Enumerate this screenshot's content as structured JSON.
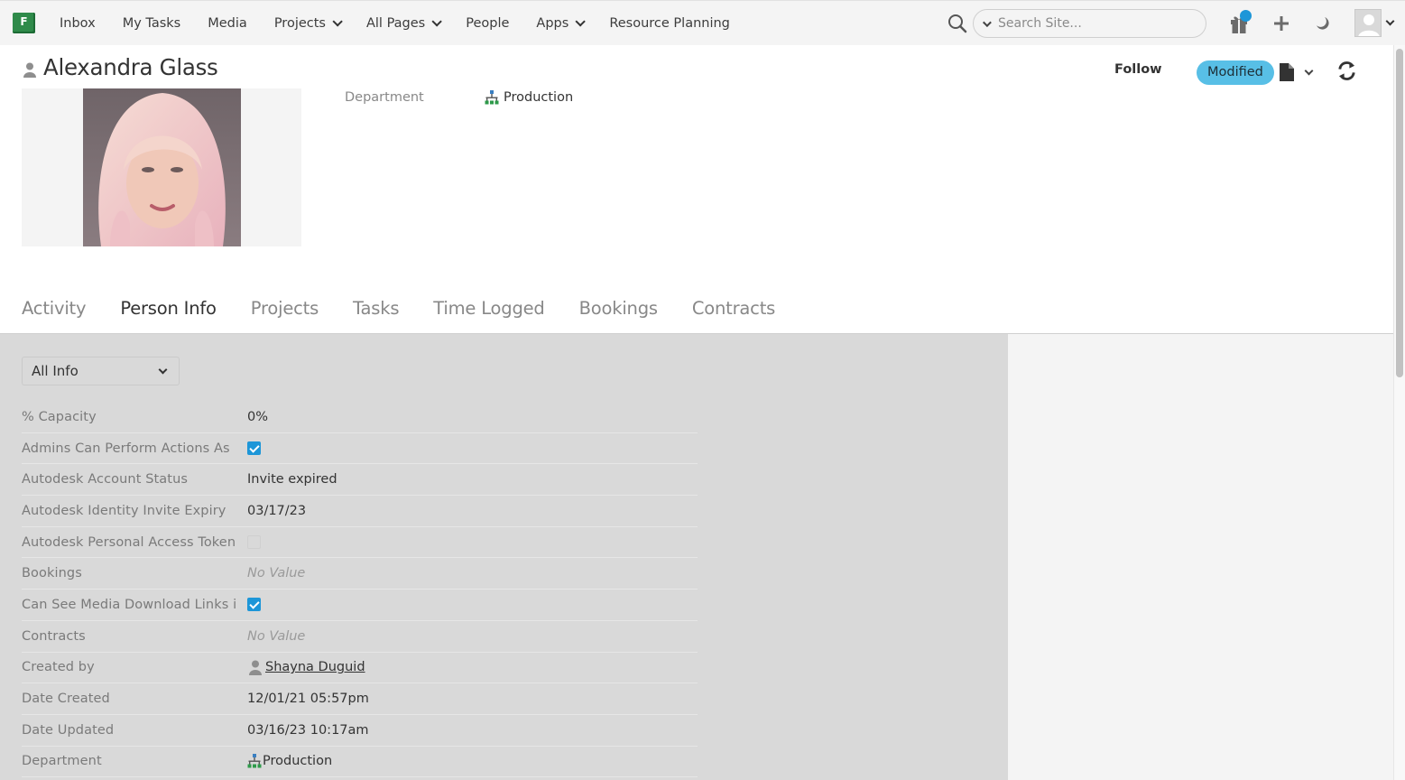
{
  "nav": {
    "logo_letter": "F",
    "items": [
      {
        "label": "Inbox",
        "has_dropdown": false
      },
      {
        "label": "My Tasks",
        "has_dropdown": false
      },
      {
        "label": "Media",
        "has_dropdown": false
      },
      {
        "label": "Projects",
        "has_dropdown": true
      },
      {
        "label": "All Pages",
        "has_dropdown": true
      },
      {
        "label": "People",
        "has_dropdown": false
      },
      {
        "label": "Apps",
        "has_dropdown": true
      },
      {
        "label": "Resource Planning",
        "has_dropdown": false
      }
    ],
    "search_placeholder": "Search Site...",
    "notification_dot_color": "#1d96d8"
  },
  "header": {
    "title": "Alexandra Glass",
    "department_label": "Department",
    "department_value": "Production",
    "follow_label": "Follow",
    "status_label": "Modified",
    "status_color": "#58bfe6"
  },
  "tabs": [
    {
      "label": "Activity",
      "active": false
    },
    {
      "label": "Person Info",
      "active": true
    },
    {
      "label": "Projects",
      "active": false
    },
    {
      "label": "Tasks",
      "active": false
    },
    {
      "label": "Time Logged",
      "active": false
    },
    {
      "label": "Bookings",
      "active": false
    },
    {
      "label": "Contracts",
      "active": false
    }
  ],
  "filter": {
    "selected": "All Info"
  },
  "fields": [
    {
      "label": "% Capacity",
      "type": "text",
      "value": "0%"
    },
    {
      "label": "Admins Can Perform Actions As",
      "type": "checkbox",
      "checked": true
    },
    {
      "label": "Autodesk Account Status",
      "type": "text",
      "value": "Invite expired"
    },
    {
      "label": "Autodesk Identity Invite Expiry",
      "type": "text",
      "value": "03/17/23"
    },
    {
      "label": "Autodesk Personal Access Token",
      "type": "checkbox",
      "checked": false
    },
    {
      "label": "Bookings",
      "type": "empty",
      "value": "No Value"
    },
    {
      "label": "Can See Media Download Links i",
      "type": "checkbox",
      "checked": true
    },
    {
      "label": "Contracts",
      "type": "empty",
      "value": "No Value"
    },
    {
      "label": "Created by",
      "type": "user",
      "value": "Shayna Duguid"
    },
    {
      "label": "Date Created",
      "type": "text",
      "value": "12/01/21 05:57pm"
    },
    {
      "label": "Date Updated",
      "type": "text",
      "value": "03/16/23 10:17am"
    },
    {
      "label": "Department",
      "type": "department",
      "value": "Production"
    }
  ],
  "colors": {
    "accent": "#1d96d8",
    "brand": "#2f8a4a",
    "content_bg": "#d9d9d9"
  }
}
